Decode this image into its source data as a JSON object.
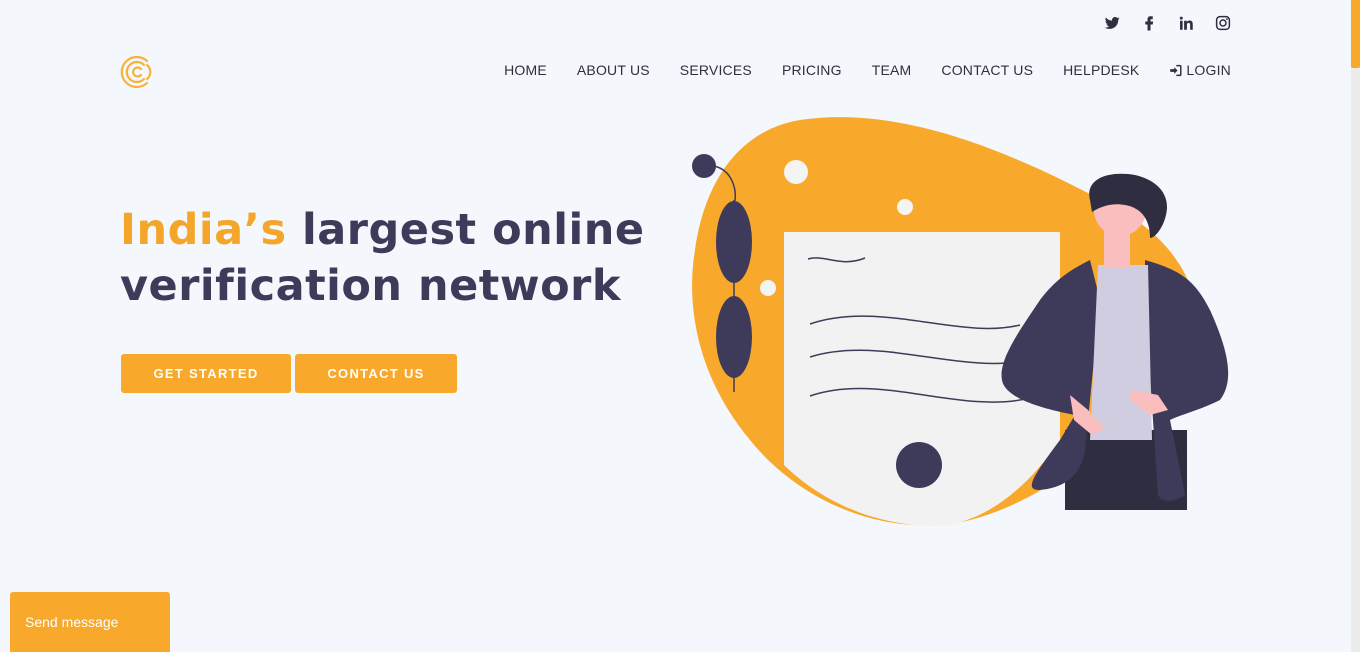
{
  "social": [
    {
      "name": "twitter-icon"
    },
    {
      "name": "facebook-icon"
    },
    {
      "name": "linkedin-icon"
    },
    {
      "name": "instagram-icon"
    }
  ],
  "nav": {
    "home": "HOME",
    "about": "ABOUT US",
    "services": "SERVICES",
    "pricing": "PRICING",
    "team": "TEAM",
    "contact": "CONTACT US",
    "helpdesk": "HELPDESK",
    "login": "LOGIN"
  },
  "hero": {
    "title_accent": "India’s",
    "title_rest_line1": " largest online",
    "title_line2": "verification network",
    "get_started": "GET STARTED",
    "contact_us": "CONTACT US"
  },
  "chat": {
    "send_message": "Send message"
  },
  "colors": {
    "accent": "#f8a82a",
    "dark": "#3d3b59",
    "background": "#f4f8fc"
  }
}
